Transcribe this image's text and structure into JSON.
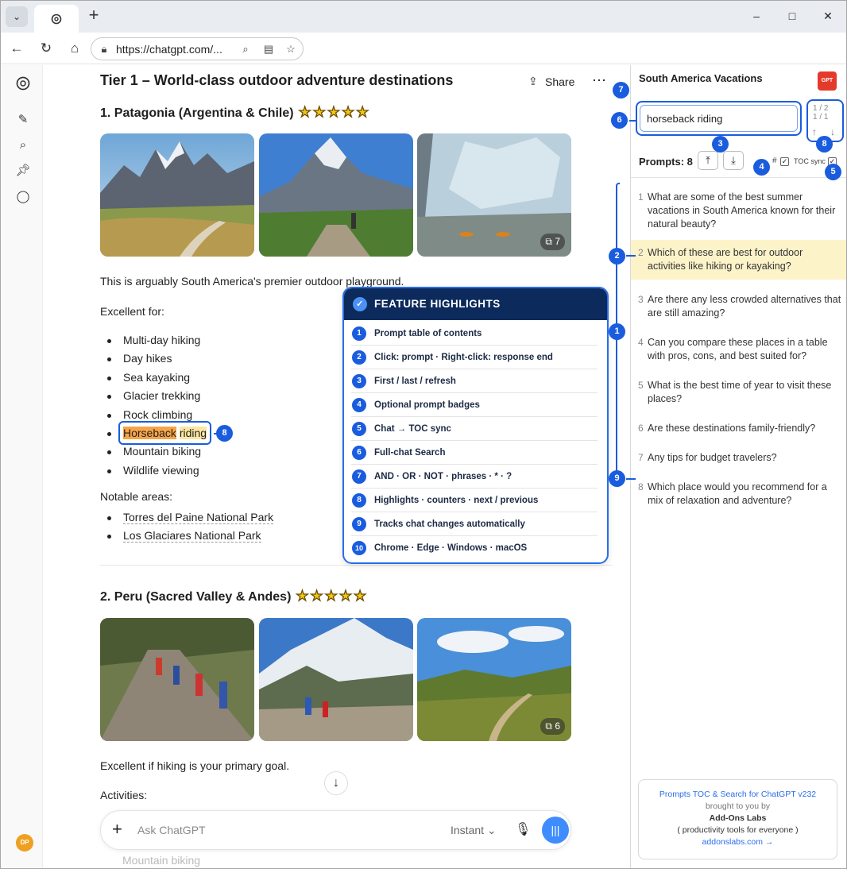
{
  "browser": {
    "url": "https://chatgpt.com/...",
    "window_controls": [
      "–",
      "□",
      "✕"
    ]
  },
  "chat": {
    "title": "Tier 1 – World-class outdoor adventure destinations",
    "share_label": "Share",
    "section1": {
      "heading": "1. Patagonia (Argentina & Chile)",
      "stars": "★★★★★",
      "image_count": "7",
      "intro": "This is arguably South America's premier outdoor playground.",
      "excellent_for_label": "Excellent for:",
      "activities": [
        "Multi-day hiking",
        "Day hikes",
        "Sea kayaking",
        "Glacier trekking",
        "Rock climbing",
        "Horseback riding",
        "Mountain biking",
        "Wildlife viewing"
      ],
      "highlight_word_1": "Horseback",
      "highlight_word_2": "riding",
      "notable_label": "Notable areas:",
      "notable_areas": [
        "Torres del Paine National Park",
        "Los Glaciares National Park"
      ]
    },
    "section2": {
      "heading": "2. Peru (Sacred Valley & Andes)",
      "stars": "★★★★★",
      "image_count": "6",
      "intro": "Excellent if hiking is your primary goal.",
      "activities_label": "Activities:",
      "faded_item": "Mountain biking"
    },
    "composer": {
      "placeholder": "Ask ChatGPT",
      "mode": "Instant"
    },
    "avatar_initials": "DP"
  },
  "features": {
    "title": "FEATURE HIGHLIGHTS",
    "items": [
      {
        "num": "1",
        "label": "Prompt table of contents"
      },
      {
        "num": "2",
        "label": "Click: prompt · Right-click: response end"
      },
      {
        "num": "3",
        "label": "First / last / refresh"
      },
      {
        "num": "4",
        "label": "Optional prompt badges"
      },
      {
        "num": "5",
        "label": "Chat → TOC sync"
      },
      {
        "num": "6",
        "label": "Full-chat Search"
      },
      {
        "num": "7",
        "label": "AND · OR · NOT · phrases · * · ?"
      },
      {
        "num": "8",
        "label": "Highlights · counters · next / previous"
      },
      {
        "num": "9",
        "label": "Tracks chat changes automatically"
      },
      {
        "num": "10",
        "label": "Chrome · Edge · Windows · macOS"
      }
    ]
  },
  "panel": {
    "title": "South America Vacations",
    "logo_text": "GPT",
    "search_value": "horseback riding",
    "counter_1": "1 / 2",
    "counter_2": "1 / 1",
    "prompts_label": "Prompts: 8",
    "hash_label": "#",
    "toc_sync_label": "TOC sync",
    "prompts": [
      {
        "num": "1",
        "text": "What are some of the best summer vacations in South America known for their natural beauty?"
      },
      {
        "num": "2",
        "text": "Which of these are best for outdoor activities like hiking or kayaking?"
      },
      {
        "num": "3",
        "text": "Are there any less crowded alternatives that are still amazing?"
      },
      {
        "num": "4",
        "text": "Can you compare these places in a table with pros, cons, and best suited for?"
      },
      {
        "num": "5",
        "text": "What is the best time of year to visit these places?"
      },
      {
        "num": "6",
        "text": "Are these destinations family-friendly?"
      },
      {
        "num": "7",
        "text": "Any tips for budget travelers?"
      },
      {
        "num": "8",
        "text": "Which place would you recommend for a mix of relaxation and adventure?"
      }
    ],
    "footer": {
      "line1": "Prompts TOC & Search for ChatGPT v232",
      "line2": "brought to you by",
      "line3": "Add-Ons Labs",
      "line4": "( productivity tools for everyone )",
      "line5": "addonslabs.com →"
    }
  },
  "annotations": [
    "1",
    "2",
    "3",
    "4",
    "5",
    "6",
    "7",
    "8",
    "8",
    "9"
  ],
  "colors": {
    "accent": "#1a5cde",
    "feature_header": "#0c2a5c",
    "highlight_strong": "#f7a448",
    "highlight_soft": "#fbe7a1",
    "active_prompt": "#fdf3c9"
  }
}
